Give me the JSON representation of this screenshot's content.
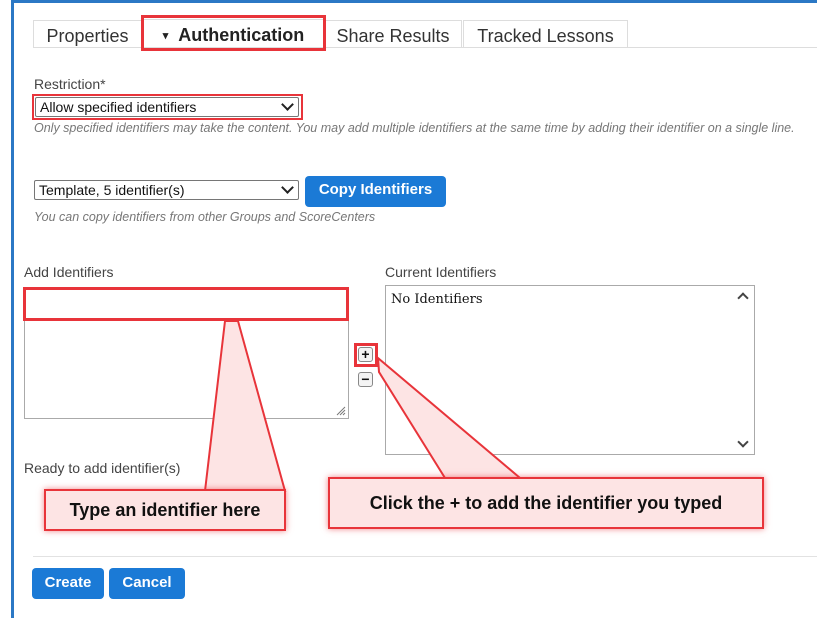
{
  "tabs": [
    {
      "label": "Properties"
    },
    {
      "label": "Authentication",
      "caret": "▾"
    },
    {
      "label": "Share Results"
    },
    {
      "label": "Tracked Lessons"
    }
  ],
  "restriction": {
    "label": "Restriction*",
    "selected": "Allow specified identifiers",
    "hint": "Only specified identifiers may take the content. You may add multiple identifiers at the same time by adding their identifier on a single line."
  },
  "copy": {
    "selected": "Template, 5 identifier(s)",
    "button": "Copy Identifiers",
    "hint": "You can copy identifiers from other Groups and ScoreCenters"
  },
  "add": {
    "label": "Add Identifiers",
    "value": "",
    "status": "Ready to add identifier(s)"
  },
  "current": {
    "label": "Current Identifiers",
    "empty_text": "No Identifiers"
  },
  "controls": {
    "add_symbol": "+",
    "remove_symbol": "−"
  },
  "annotations": {
    "type_here": "Type an identifier here",
    "click_plus": "Click the + to add the identifier you typed"
  },
  "footer": {
    "create": "Create",
    "cancel": "Cancel"
  },
  "colors": {
    "accent": "#1b7ad6",
    "annotation_red": "#e8343a",
    "frame": "#2b78c5"
  }
}
